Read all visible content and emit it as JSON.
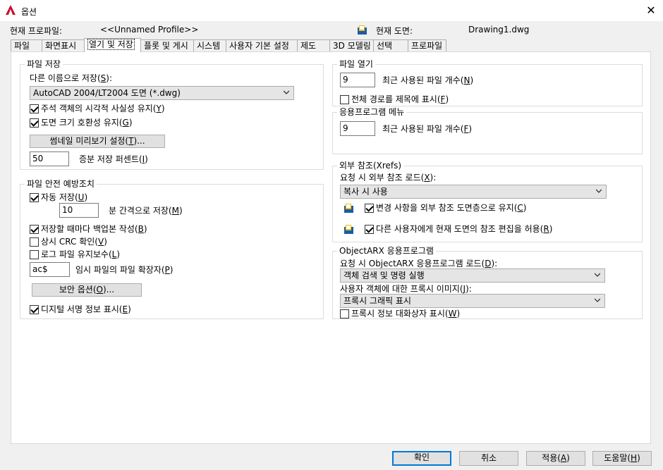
{
  "window": {
    "title": "옵션",
    "close_label": "✕"
  },
  "header": {
    "profile_label": "현재 프로파일:",
    "profile_value": "<<Unnamed Profile>>",
    "drawing_label": "현재 도면:",
    "drawing_value": "Drawing1.dwg"
  },
  "tabs": [
    "파일",
    "화면표시",
    "열기 및 저장",
    "플롯 및 게시",
    "시스템",
    "사용자 기본 설정",
    "제도",
    "3D 모델링",
    "선택",
    "프로파일"
  ],
  "file_save": {
    "legend": "파일 저장",
    "save_as_label": "다른 이름으로 저장(",
    "save_as_key": "S",
    "save_as_value": "AutoCAD 2004/LT2004 도면 (*.dwg)",
    "annot_label": "주석 객체의 시각적 사실성 유지(",
    "annot_key": "Y",
    "size_label": "도면 크기 호환성 유지(",
    "size_key": "G",
    "thumb_label": "썸네일 미리보기 설정(",
    "thumb_key": "T",
    "thumb_suffix": ")...",
    "incr_value": "50",
    "incr_label": "증분 저장 퍼센트(",
    "incr_key": "I"
  },
  "file_safety": {
    "legend": "파일 안전 예방조치",
    "autosave_label": "자동 저장(",
    "autosave_key": "U",
    "minutes_value": "10",
    "minutes_label": "분 간격으로 저장(",
    "minutes_key": "M",
    "backup_label": "저장할 때마다 백업본 작성(",
    "backup_key": "B",
    "crc_label": "상시 CRC 확인(",
    "crc_key": "V",
    "log_label": "로그 파일 유지보수(",
    "log_key": "L",
    "ext_value": "ac$",
    "ext_label": "임시 파일의 파일 확장자(",
    "ext_key": "P",
    "security_label": "보안 옵션(",
    "security_key": "O",
    "security_suffix": ")...",
    "digsig_label": "디지털 서명 정보 표시(",
    "digsig_key": "E"
  },
  "file_open": {
    "legend": "파일 열기",
    "recent_value": "9",
    "recent_label": "최근 사용된 파일 개수(",
    "recent_key": "N",
    "fullpath_label": "전체 경로를 제목에 표시(",
    "fullpath_key": "F"
  },
  "app_menu": {
    "legend": "응용프로그램 메뉴",
    "recent_value": "9",
    "recent_label": "최근 사용된 파일 개수(",
    "recent_key": "F"
  },
  "xrefs": {
    "legend": "외부 참조(Xrefs)",
    "demand_label": "요청 시 외부 참조 로드(",
    "demand_key": "X",
    "demand_value": "복사 시 사용",
    "retain_label": "변경 사항을 외부 참조 도면층으로 유지(",
    "retain_key": "C",
    "allow_label": "다른 사용자에게 현재 도면의 참조 편집을 허용(",
    "allow_key": "R"
  },
  "objectarx": {
    "legend": "ObjectARX 응용프로그램",
    "demand_label": "요청 시 ObjectARX 응용프로그램 로드(",
    "demand_key": "D",
    "demand_value": "객체 검색 및 명령 실행",
    "proxy_label": "사용자 객체에 대한 프록시 이미지(",
    "proxy_key": "J",
    "proxy_value": "프록시 그래픽 표시",
    "dialog_label": "프록시 정보 대화상자 표시(",
    "dialog_key": "W"
  },
  "buttons": {
    "ok": "확인",
    "cancel": "취소",
    "apply_label": "적용(",
    "apply_key": "A",
    "help_label": "도움말(",
    "help_key": "H"
  },
  "colors": {
    "accent": "#0078d7",
    "app_red": "#c8102e"
  },
  "icons": {
    "app": "autocad-logo-icon",
    "drawing": "drawing-file-icon",
    "combo": "chevron-down-icon"
  }
}
